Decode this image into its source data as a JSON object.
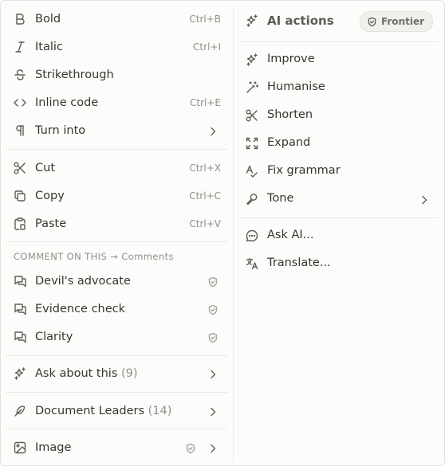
{
  "left": {
    "format": [
      {
        "label": "Bold",
        "shortcut": "Ctrl+B",
        "icon": "bold-icon"
      },
      {
        "label": "Italic",
        "shortcut": "Ctrl+I",
        "icon": "italic-icon"
      },
      {
        "label": "Strikethrough",
        "shortcut": "",
        "icon": "strikethrough-icon"
      },
      {
        "label": "Inline code",
        "shortcut": "Ctrl+E",
        "icon": "code-icon"
      },
      {
        "label": "Turn into",
        "shortcut": "",
        "icon": "pilcrow-icon"
      }
    ],
    "clipboard": [
      {
        "label": "Cut",
        "shortcut": "Ctrl+X",
        "icon": "scissors-icon"
      },
      {
        "label": "Copy",
        "shortcut": "Ctrl+C",
        "icon": "copy-icon"
      },
      {
        "label": "Paste",
        "shortcut": "Ctrl+V",
        "icon": "clipboard-icon"
      }
    ],
    "comment_section_label": "COMMENT ON THIS → Comments",
    "comments": [
      {
        "label": "Devil's advocate",
        "icon": "chat-bubbles-icon"
      },
      {
        "label": "Evidence check",
        "icon": "chat-bubbles-icon"
      },
      {
        "label": "Clarity",
        "icon": "chat-bubbles-icon"
      }
    ],
    "ask": {
      "label": "Ask about this",
      "count": "(9)",
      "icon": "sparkles-icon"
    },
    "leaders": {
      "label": "Document Leaders",
      "count": "(14)",
      "icon": "feather-icon"
    },
    "image": {
      "label": "Image",
      "icon": "image-icon"
    }
  },
  "right": {
    "title": "AI actions",
    "badge": "Frontier",
    "actions": [
      {
        "label": "Improve",
        "icon": "sparkles-icon"
      },
      {
        "label": "Humanise",
        "icon": "magic-wand-icon"
      },
      {
        "label": "Shorten",
        "icon": "scissors-icon"
      },
      {
        "label": "Expand",
        "icon": "expand-icon"
      },
      {
        "label": "Fix grammar",
        "icon": "spellcheck-icon"
      },
      {
        "label": "Tone",
        "icon": "microphone-icon"
      }
    ],
    "more": [
      {
        "label": "Ask AI...",
        "icon": "chat-bubble-icon"
      },
      {
        "label": "Translate...",
        "icon": "translate-icon"
      }
    ]
  }
}
